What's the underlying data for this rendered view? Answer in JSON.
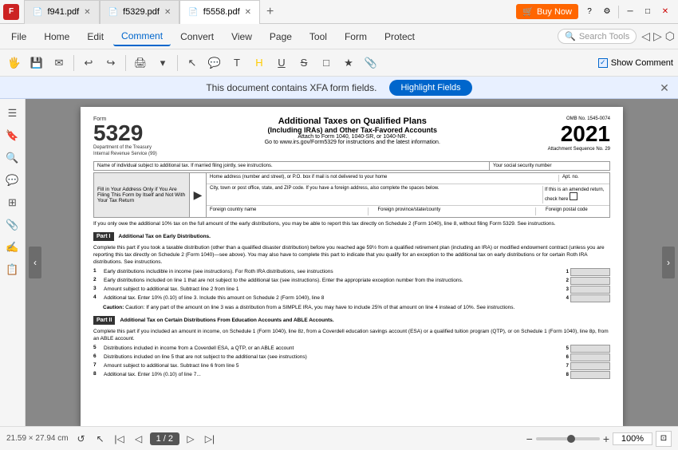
{
  "app": {
    "icon": "F",
    "tabs": [
      {
        "id": "tab1",
        "filename": "f941.pdf",
        "active": false,
        "closeable": true
      },
      {
        "id": "tab2",
        "filename": "f5329.pdf",
        "active": false,
        "closeable": true
      },
      {
        "id": "tab3",
        "filename": "f5558.pdf",
        "active": true,
        "closeable": true
      }
    ],
    "buy_now": "Buy Now"
  },
  "menubar": {
    "items": [
      "File",
      "Home",
      "Edit",
      "Comment",
      "Convert",
      "View",
      "Page",
      "Tool",
      "Form",
      "Protect"
    ],
    "active": "Comment",
    "search_placeholder": "Search Tools"
  },
  "toolbar": {
    "show_comment": "Show Comment"
  },
  "xfa_bar": {
    "message": "This document contains XFA form fields.",
    "highlight_btn": "Highlight Fields"
  },
  "document": {
    "form_word": "Form",
    "form_number": "5329",
    "department": "Department of the Treasury Internal Revenue Service (99)",
    "title": "Additional Taxes on Qualified Plans",
    "subtitle": "(Including IRAs) and Other Tax-Favored Accounts",
    "attach_line1": "Attach to Form 1040, 1040-SR, or 1040-NR.",
    "attach_line2": "Go to www.irs.gov/Form5329 for instructions and the latest information.",
    "omb": "OMB No. 1545-0074",
    "year": "2021",
    "attachment": "Attachment Sequence No. 29",
    "fields": {
      "name_label": "Name of individual subject to additional tax. If married filing jointly, see instructions.",
      "ssn_label": "Your social security number",
      "home_address_label": "Home address (number and street), or P.O. box if mail is not delivered to your home",
      "apt_label": "Apt. no.",
      "city_label": "City, town or post office, state, and ZIP code. If you have a foreign address, also complete the spaces below.",
      "see_instructions": "See instructions.",
      "amended_label": "If this is an amended return, check here",
      "foreign_country": "Foreign country name",
      "foreign_province": "Foreign province/state/county",
      "foreign_postal": "Foreign postal code",
      "address_box_label": "Fill in Your Address Only if You Are Filing This Form by Itself and Not With Your Tax Return"
    },
    "warning": "If you only owe the additional 10% tax on the full amount of the early distributions, you may be able to report this tax directly on Schedule 2 (Form 1040), line 8, without filing Form 5329. See instructions.",
    "part1": {
      "label": "Part I",
      "title": "Additional Tax on Early Distributions.",
      "desc": "Complete this part if you took a taxable distribution (other than a qualified disaster distribution) before you reached age 59½ from a qualified retirement plan (including an IRA) or modified endowment contract (unless you are reporting this tax directly on Schedule 2 (Form 1040)—see above). You may also have to complete this part to indicate that you qualify for an exception to the additional tax on early distributions or for certain Roth IRA distributions. See instructions.",
      "lines": [
        {
          "num": "1",
          "desc": "Early distributions includible in income (see instructions). For Roth IRA distributions, see instructions",
          "box_num": "1"
        },
        {
          "num": "2",
          "desc": "Early distributions included on line 1 that are not subject to the additional tax (see instructions).\nEnter the appropriate exception number from the instructions.",
          "box_num": "2"
        },
        {
          "num": "3",
          "desc": "Amount subject to additional tax. Subtract line 2 from line 1",
          "box_num": "3"
        },
        {
          "num": "4",
          "desc": "Additional tax. Enter 10% (0.10) of line 3. Include this amount on Schedule 2 (Form 1040), line 8",
          "box_num": "4"
        }
      ],
      "caution": "Caution: If any part of the amount on line 3 was a distribution from a SIMPLE IRA, you may have to include 25% of that amount on line 4 instead of 10%. See instructions."
    },
    "part2": {
      "label": "Part II",
      "title": "Additional Tax on Certain Distributions From Education Accounts and ABLE Accounts.",
      "desc": "Complete this part if you included an amount in income, on Schedule 1 (Form 1040), line 8z, from a Coverdell education savings account (ESA) or a qualified tuition program (QTP), or on Schedule 1 (Form 1040), line 8p, from an ABLE account.",
      "lines": [
        {
          "num": "5",
          "desc": "Distributions included in income from a Coverdell ESA, a QTP, or an ABLE account",
          "box_num": "5"
        },
        {
          "num": "6",
          "desc": "Distributions included on line 5 that are not subject to the additional tax (see instructions)",
          "box_num": "6"
        },
        {
          "num": "7",
          "desc": "Amount subject to additional tax. Subtract line 6 from line 5",
          "box_num": "7"
        },
        {
          "num": "8",
          "desc": "Additional tax. Enter 10% (0.10) of line 7...",
          "box_num": "8"
        }
      ]
    }
  },
  "bottom_bar": {
    "doc_size": "21.59 × 27.94 cm",
    "page_current": "1",
    "page_total": "2",
    "page_label": "1 / 2",
    "zoom_percent": "100%"
  }
}
